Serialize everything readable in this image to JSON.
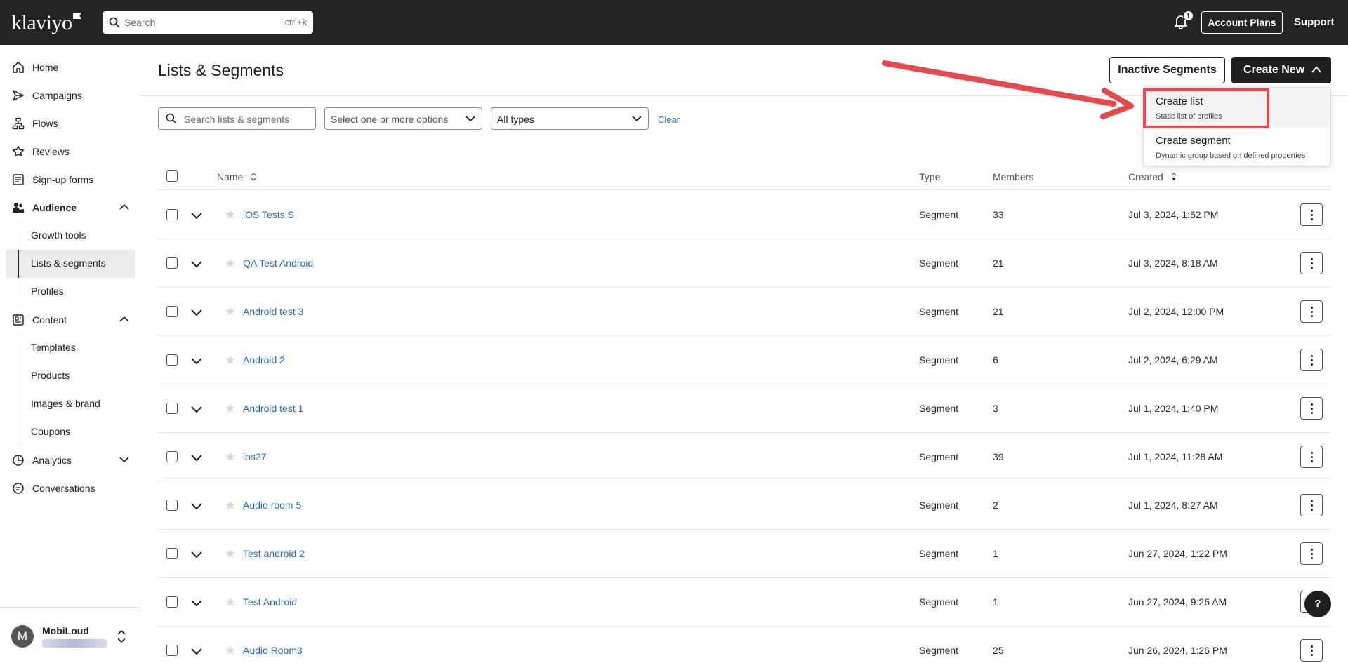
{
  "topbar": {
    "logo": "klaviyo",
    "search_placeholder": "Search",
    "search_shortcut": "ctrl+k",
    "notification_count": "1",
    "account_plans_label": "Account Plans",
    "support_label": "Support"
  },
  "sidebar": {
    "items": [
      {
        "label": "Home",
        "icon": "home-icon"
      },
      {
        "label": "Campaigns",
        "icon": "send-icon"
      },
      {
        "label": "Flows",
        "icon": "flow-icon"
      },
      {
        "label": "Reviews",
        "icon": "star-icon"
      },
      {
        "label": "Sign-up forms",
        "icon": "form-icon"
      },
      {
        "label": "Audience",
        "icon": "people-icon",
        "expanded": true
      },
      {
        "label": "Content",
        "icon": "content-icon",
        "expanded": true
      },
      {
        "label": "Analytics",
        "icon": "analytics-icon",
        "expanded": false
      },
      {
        "label": "Conversations",
        "icon": "chat-icon"
      }
    ],
    "audience_sub": [
      "Growth tools",
      "Lists & segments",
      "Profiles"
    ],
    "content_sub": [
      "Templates",
      "Products",
      "Images & brand",
      "Coupons"
    ],
    "active_sub": "Lists & segments",
    "account_name": "MobiLoud",
    "account_initial": "M"
  },
  "page": {
    "title": "Lists & Segments",
    "inactive_segments_label": "Inactive Segments",
    "create_new_label": "Create New"
  },
  "filters": {
    "search_placeholder": "Search lists & segments",
    "tags_placeholder": "Select one or more options",
    "type_value": "All types",
    "clear_label": "Clear"
  },
  "table": {
    "headers": {
      "name": "Name",
      "type": "Type",
      "members": "Members",
      "created": "Created"
    },
    "rows": [
      {
        "name": "iOS Tests S",
        "type": "Segment",
        "members": "33",
        "created": "Jul 3, 2024, 1:52 PM"
      },
      {
        "name": "QA Test Android",
        "type": "Segment",
        "members": "21",
        "created": "Jul 3, 2024, 8:18 AM"
      },
      {
        "name": "Android test 3",
        "type": "Segment",
        "members": "21",
        "created": "Jul 2, 2024, 12:00 PM"
      },
      {
        "name": "Android 2",
        "type": "Segment",
        "members": "6",
        "created": "Jul 2, 2024, 6:29 AM"
      },
      {
        "name": "Android test 1",
        "type": "Segment",
        "members": "3",
        "created": "Jul 1, 2024, 1:40 PM"
      },
      {
        "name": "ios27",
        "type": "Segment",
        "members": "39",
        "created": "Jul 1, 2024, 11:28 AM"
      },
      {
        "name": "Audio room 5",
        "type": "Segment",
        "members": "2",
        "created": "Jul 1, 2024, 8:27 AM"
      },
      {
        "name": "Test android 2",
        "type": "Segment",
        "members": "1",
        "created": "Jun 27, 2024, 1:22 PM"
      },
      {
        "name": "Test Android",
        "type": "Segment",
        "members": "1",
        "created": "Jun 27, 2024, 9:26 AM"
      },
      {
        "name": "Audio Room3",
        "type": "Segment",
        "members": "25",
        "created": "Jun 26, 2024, 1:26 PM"
      }
    ]
  },
  "dropdown": {
    "items": [
      {
        "title": "Create list",
        "subtitle": "Static list of profiles"
      },
      {
        "title": "Create segment",
        "subtitle": "Dynamic group based on defined properties"
      }
    ]
  },
  "help_label": "?",
  "colors": {
    "topbar": "#232426",
    "link": "#2b6bb2",
    "annotation": "#e5484d"
  }
}
